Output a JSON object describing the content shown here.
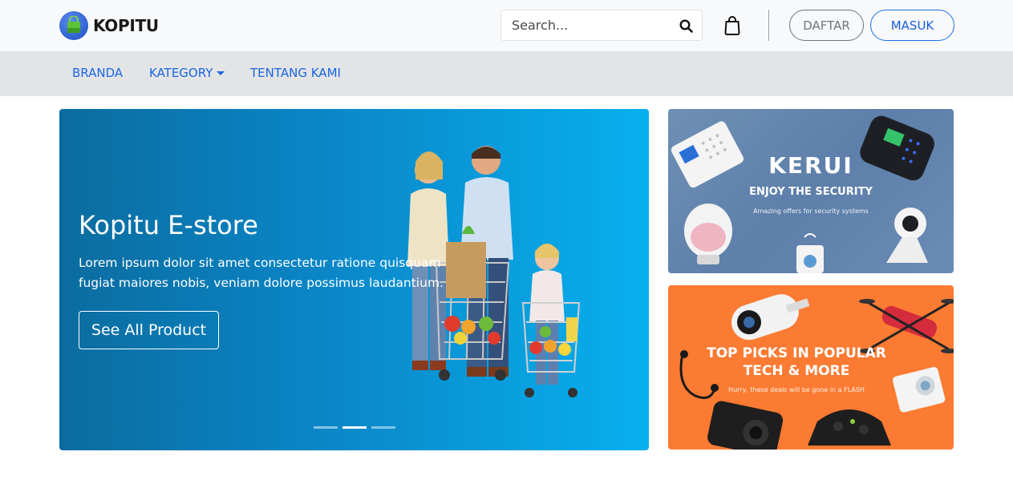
{
  "header": {
    "brand_name": "KOPITU",
    "search_placeholder": "Search...",
    "register_label": "DAFTAR",
    "login_label": "MASUK"
  },
  "nav": {
    "items": [
      {
        "label": "BRANDA"
      },
      {
        "label": "KATEGORY"
      },
      {
        "label": "TENTANG KAMI"
      }
    ]
  },
  "hero": {
    "title": "Kopitu E-store",
    "description": "Lorem ipsum dolor sit amet consectetur ratione quisquam fugiat maiores nobis, veniam dolore possimus laudantium.",
    "button_label": "See All Product",
    "slide_count": 3,
    "active_slide": 2
  },
  "banners": {
    "security": {
      "brand": "KERUI",
      "tagline": "ENJOY THE SECURITY",
      "subtitle": "Amazing offers for security systems"
    },
    "tech": {
      "title_line1": "TOP PICKS IN POPULAR",
      "title_line2": "TECH & MORE",
      "subtitle": "Hurry, these deals will be gone in a FLASH"
    }
  },
  "colors": {
    "topbar_bg": "#f8f9fa",
    "navbar_bg": "#e3e4e6",
    "link_blue": "#1a66e0",
    "hero_gradient_start": "#0b6c9f",
    "hero_gradient_end": "#08b0ef",
    "tech_banner_bg": "#fb7b33",
    "security_banner_bg": "#6f8fb5"
  },
  "icons": {
    "logo": "shopping-bag-logo-icon",
    "search": "search-icon",
    "cart": "shopping-bag-icon",
    "dropdown": "caret-down-icon"
  }
}
